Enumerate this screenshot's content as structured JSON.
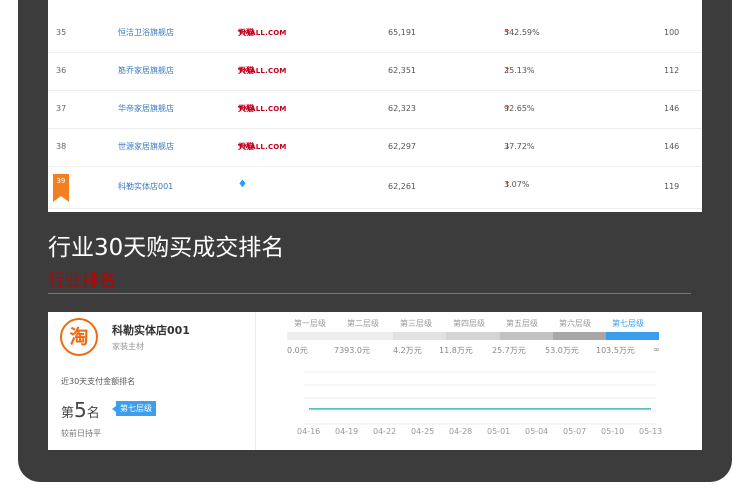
{
  "ranking_table": {
    "rows": [
      {
        "rank": "35",
        "store": "恒洁卫浴旗舰店",
        "platform_cn": "天猫",
        "platform_en": "TMALL.COM",
        "value": "65,191",
        "change": "542.59%",
        "direction": "up",
        "count": "100"
      },
      {
        "rank": "36",
        "store": "筋乔家居旗舰店",
        "platform_cn": "天猫",
        "platform_en": "TMALL.COM",
        "value": "62,351",
        "change": "25.13%",
        "direction": "up",
        "count": "112"
      },
      {
        "rank": "37",
        "store": "华帝家居旗舰店",
        "platform_cn": "天猫",
        "platform_en": "TMALL.COM",
        "value": "62,323",
        "change": "92.65%",
        "direction": "up",
        "count": "146"
      },
      {
        "rank": "38",
        "store": "世源家居旗舰店",
        "platform_cn": "天猫",
        "platform_en": "TMALL.COM",
        "value": "62,297",
        "change": "37.72%",
        "direction": "down",
        "count": "146"
      },
      {
        "rank": "39",
        "store": "科勒实体店001",
        "platform_cn": "",
        "platform_en": "",
        "value": "62,261",
        "change": "3.07%",
        "direction": "up",
        "count": "119",
        "highlight": true,
        "diamonds": 5
      }
    ]
  },
  "section": {
    "title": "行业30天购买成交排名",
    "subtitle": "行业排名"
  },
  "store_card": {
    "logo_char": "淘",
    "store_name": "科勒实体店001",
    "category": "家装主材",
    "rank_label": "近30天支付金额排名",
    "rank_prefix": "第",
    "rank_number": "5",
    "rank_suffix": "名",
    "tier_badge": "第七层级",
    "rank_change": "较前日持平",
    "tiers": [
      "第一层级",
      "第二层级",
      "第三层级",
      "第四层级",
      "第五层级",
      "第六层级",
      "第七层级"
    ],
    "active_tier": 6,
    "thresholds": [
      "0.0元",
      "7393.0元",
      "4.2万元",
      "11.8万元",
      "25.7万元",
      "53.0万元",
      "103.5万元",
      "∞"
    ],
    "tier_colors": [
      "#eeeeee",
      "#eeeeee",
      "#e2e2e2",
      "#d4d4d4",
      "#c2c2c2",
      "#a8a8a8",
      "#3b9eef"
    ]
  },
  "chart_data": {
    "type": "line",
    "x": [
      "04-16",
      "04-19",
      "04-22",
      "04-25",
      "04-28",
      "05-01",
      "05-04",
      "05-07",
      "05-10",
      "05-13"
    ],
    "series": [
      {
        "values": [
          5,
          5,
          5,
          5,
          5,
          5,
          5,
          5,
          5,
          5
        ],
        "color": "#3fb4bd"
      }
    ],
    "grid": true
  },
  "icons": {
    "up_arrow": "↑",
    "down_arrow": "↓",
    "diamond": "♦"
  },
  "colors": {
    "accent_blue": "#3b9eef",
    "rank_badge_orange": "#f47f20",
    "tmall_red": "#c4001c",
    "heading_red": "#c00000"
  }
}
